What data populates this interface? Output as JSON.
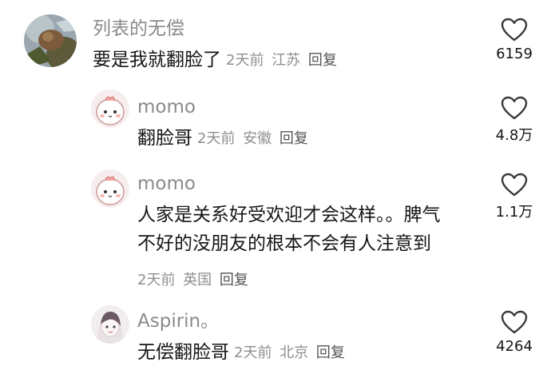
{
  "comments": [
    {
      "username": "列表的无偿",
      "text": "要是我就翻脸了",
      "time": "2天前",
      "location": "江苏",
      "reply": "回复",
      "likes": "6159"
    },
    {
      "username": "momo",
      "text": "翻脸哥",
      "time": "2天前",
      "location": "安徽",
      "reply": "回复",
      "likes": "4.8万"
    },
    {
      "username": "momo",
      "text_line1": "人家是关系好受欢迎才会这样。。脾气",
      "text_line2": "不好的没朋友的根本不会有人注意到",
      "time": "2天前",
      "location": "英国",
      "reply": "回复",
      "likes": "1.1万"
    },
    {
      "username": "Aspirin。",
      "text": "无偿翻脸哥",
      "time": "2天前",
      "location": "北京",
      "reply": "回复",
      "likes": "4264"
    }
  ]
}
